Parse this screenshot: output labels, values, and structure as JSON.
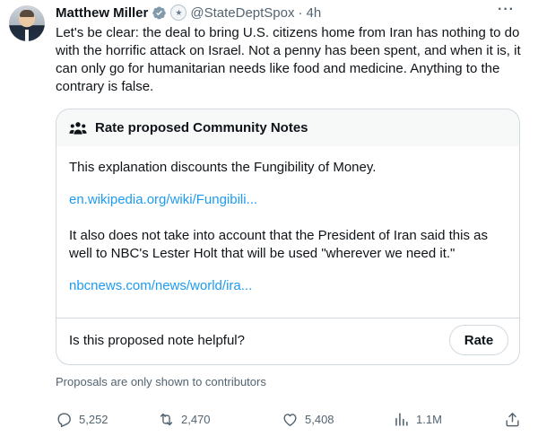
{
  "tweet": {
    "author_name": "Matthew Miller",
    "handle": "@StateDeptSpox",
    "separator": "·",
    "time": "4h",
    "more_label": "···",
    "text": "Let's be clear: the deal to bring U.S. citizens home from Iran has nothing to do with the horrific attack on Israel. Not a penny has been spent, and when it is, it can only go for humanitarian needs like food and medicine. Anything to the contrary is false."
  },
  "community_notes": {
    "header": "Rate proposed Community Notes",
    "note_line1": "This explanation discounts the Fungibility of Money.",
    "link1": "en.wikipedia.org/wiki/Fungibili...",
    "note_line2": "It also does not take into account that the President of Iran said this as well to NBC's Lester Holt that will be used \"wherever we need it.\"",
    "link2": "nbcnews.com/news/world/ira...",
    "question": "Is this proposed note helpful?",
    "rate_label": "Rate"
  },
  "proposals_note": "Proposals are only shown to contributors",
  "actions": {
    "replies": "5,252",
    "reposts": "2,470",
    "likes": "5,408",
    "views": "1.1M"
  },
  "icons": {
    "verified": "verified-badge-icon",
    "government": "state-dept-seal-icon",
    "people": "people-icon",
    "reply": "reply-icon",
    "repost": "repost-icon",
    "like": "heart-icon",
    "views": "views-chart-icon",
    "share": "share-icon"
  },
  "colors": {
    "link": "#1d9bf0",
    "secondary_text": "#536471",
    "border": "#cfd9de",
    "verified": "#829aab"
  }
}
